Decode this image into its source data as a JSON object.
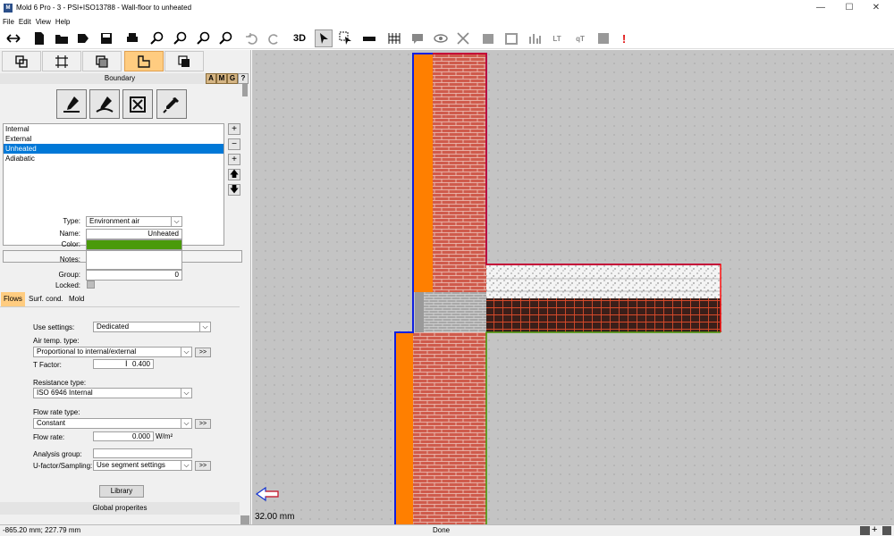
{
  "window": {
    "icon_text": "M",
    "title": "Mold 6 Pro - 3 - PSI+ISO13788 - Wall-floor to unheated",
    "minimize": "—",
    "maximize": "☐",
    "close": "✕"
  },
  "menu": [
    "File",
    "Edit",
    "View",
    "Help"
  ],
  "toolbar": {
    "view_3d_label": "3D"
  },
  "boundary": {
    "header": "Boundary",
    "amg": [
      "A",
      "M",
      "G",
      "?"
    ],
    "list": [
      "Internal",
      "External",
      "Unheated",
      "Adiabatic"
    ],
    "selected_index": 2
  },
  "properties": {
    "type_label": "Type:",
    "type_value": "Environment air",
    "name_label": "Name:",
    "name_value": "Unheated",
    "color_label": "Color:",
    "color_value": "#4a9a0a",
    "notes_label": "Notes:",
    "group_label": "Group:",
    "group_value": "0",
    "locked_label": "Locked:"
  },
  "subtabs": [
    "Flows",
    "Surf. cond.",
    "Mold"
  ],
  "flows": {
    "use_settings_label": "Use settings:",
    "use_settings_value": "Dedicated",
    "air_temp_label": "Air temp. type:",
    "air_temp_value": "Proportional to internal/external",
    "t_factor_label": "T Factor:",
    "t_factor_value": "0.400",
    "resistance_label": "Resistance type:",
    "resistance_value": "ISO 6946 Internal",
    "flow_rate_type_label": "Flow rate type:",
    "flow_rate_type_value": "Constant",
    "flow_rate_label": "Flow rate:",
    "flow_rate_value": "0.000",
    "flow_rate_unit": "W/m²",
    "analysis_group_label": "Analysis group:",
    "u_factor_label": "U-factor/Sampling:",
    "u_factor_value": "Use segment settings",
    "more": ">>"
  },
  "library_label": "Library",
  "global_properties_label": "Global properites",
  "canvas": {
    "scale_label": "32.00 mm"
  },
  "status": {
    "coords": "-865.20 mm; 227.79 mm",
    "state": "Done"
  }
}
